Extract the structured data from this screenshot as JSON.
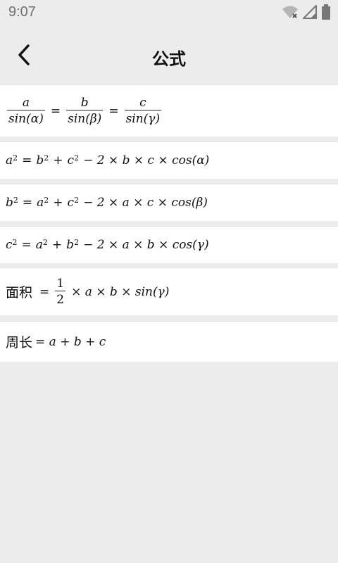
{
  "status_bar": {
    "time": "9:07"
  },
  "app_bar": {
    "title": "公式"
  },
  "formulas": {
    "law_of_sines": {
      "n1": "a",
      "d1": "sin(α)",
      "eq": "=",
      "n2": "b",
      "d2": "sin(β)",
      "n3": "c",
      "d3": "sin(γ)"
    },
    "cos_a": {
      "lhs": "a",
      "rhs1": "b",
      "rhs2": "c",
      "tail": "− 2 × b × c × cos(α)"
    },
    "cos_b": {
      "lhs": "b",
      "rhs1": "a",
      "rhs2": "c",
      "tail": "− 2 × a × c × cos(β)"
    },
    "cos_c": {
      "lhs": "c",
      "rhs1": "a",
      "rhs2": "b",
      "tail": "− 2 × a × b × cos(γ)"
    },
    "area": {
      "label": "面积",
      "num": "1",
      "den": "2",
      "rest": "× a × b × sin(γ)"
    },
    "perimeter": {
      "label": "周长",
      "expr": "= a + b + c"
    }
  },
  "colors": {
    "background": "#ececec",
    "card": "#ffffff"
  }
}
